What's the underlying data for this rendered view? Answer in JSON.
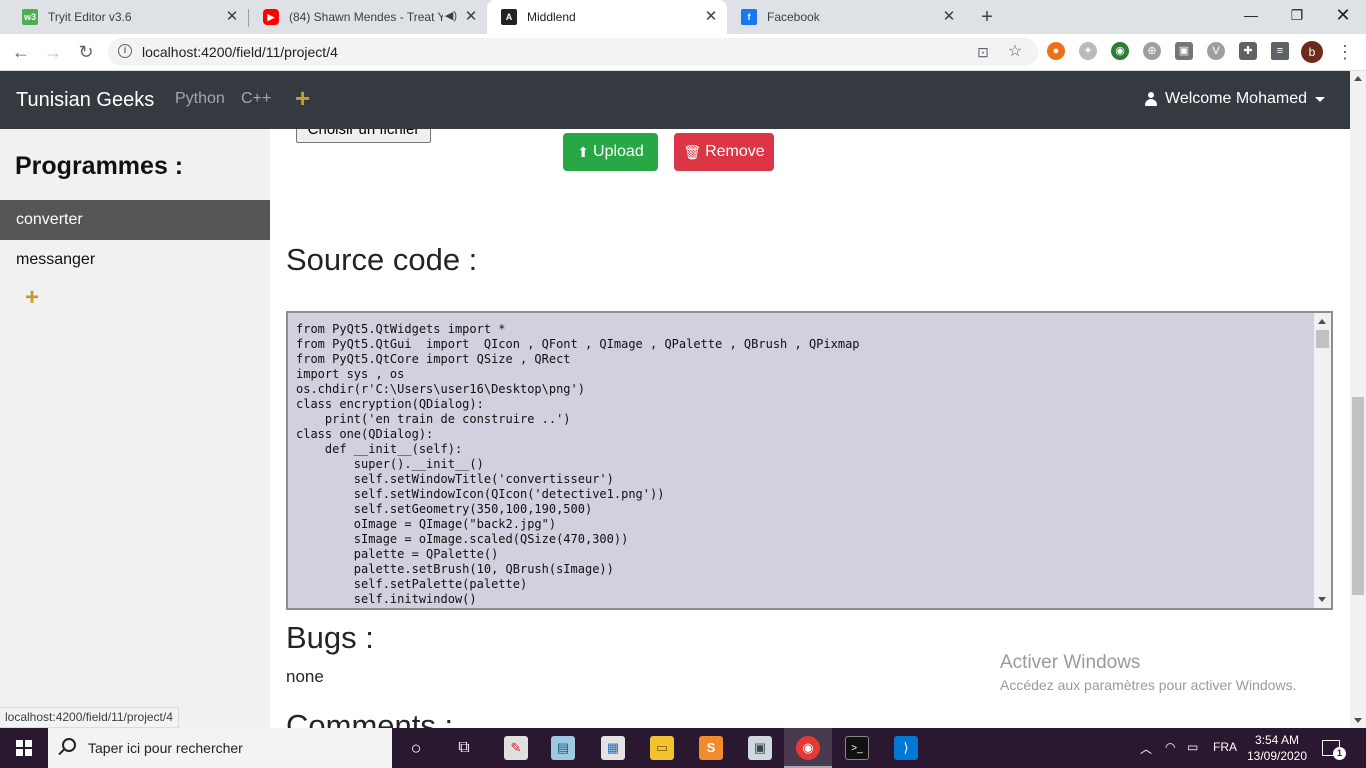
{
  "browser": {
    "tabs": [
      {
        "title": "Tryit Editor v3.6",
        "icon": "w3schools-icon",
        "color": "#4caf50"
      },
      {
        "title": "(84) Shawn Mendes - Treat Y",
        "icon": "youtube-icon",
        "color": "#ff0000"
      },
      {
        "title": "Middlend",
        "icon": "angular-icon",
        "color": "#222222"
      },
      {
        "title": "Facebook",
        "icon": "facebook-icon",
        "color": "#1877f2"
      }
    ],
    "url": "localhost:4200/field/11/project/4",
    "profile_initial": "b"
  },
  "navbar": {
    "brand": "Tunisian Geeks",
    "links": [
      "Python",
      "C++"
    ],
    "plus": "+",
    "welcome": "Welcome Mohamed"
  },
  "sidebar": {
    "title": "Programmes :",
    "items": [
      {
        "label": "converter",
        "active": true
      },
      {
        "label": "messanger",
        "active": false
      }
    ],
    "plus": "+"
  },
  "main": {
    "file_button": "Choisir un fichier",
    "upload_label": "Upload",
    "remove_label": "Remove",
    "source_heading": "Source code :",
    "source_code": "from PyQt5.QtWidgets import *\nfrom PyQt5.QtGui  import  QIcon , QFont , QImage , QPalette , QBrush , QPixmap\nfrom PyQt5.QtCore import QSize , QRect\nimport sys , os\nos.chdir(r'C:\\Users\\user16\\Desktop\\png')\nclass encryption(QDialog):\n    print('en train de construire ..')\nclass one(QDialog):\n    def __init__(self):\n        super().__init__()\n        self.setWindowTitle('convertisseur')\n        self.setWindowIcon(QIcon('detective1.png'))\n        self.setGeometry(350,100,190,500)\n        oImage = QImage(\"back2.jpg\")\n        sImage = oImage.scaled(QSize(470,300))\n        palette = QPalette()\n        palette.setBrush(10, QBrush(sImage))\n        self.setPalette(palette)\n        self.initwindow()",
    "bugs_heading": "Bugs :",
    "bugs_text": "none",
    "comments_heading": "Comments :"
  },
  "status_bar_url": "localhost:4200/field/11/project/4",
  "watermark": {
    "title": "Activer Windows",
    "subtitle": "Accédez aux paramètres pour activer Windows."
  },
  "taskbar": {
    "search_placeholder": "Taper ici pour rechercher",
    "language": "FRA",
    "time": "3:54 AM",
    "date": "13/09/2020",
    "notification_count": "1"
  },
  "colors": {
    "navbar_bg": "#343a40",
    "accent_plus": "#c99a2e",
    "upload_green": "#28a745",
    "remove_red": "#dc3545",
    "code_bg": "#d0d0de"
  }
}
